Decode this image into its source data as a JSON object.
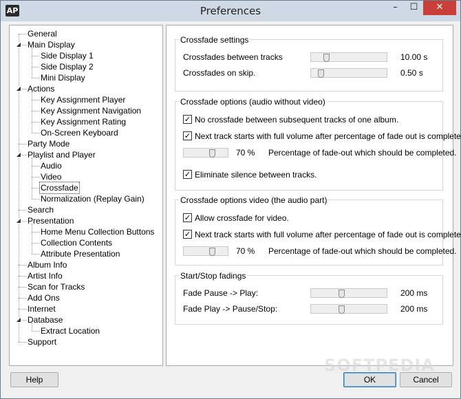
{
  "window": {
    "title": "Preferences",
    "app_icon_text": "AP",
    "minimize_glyph": "–",
    "maximize_glyph": "☐",
    "close_glyph": "✕"
  },
  "tree": {
    "items": [
      {
        "label": "General",
        "level": 0,
        "expander": ""
      },
      {
        "label": "Main Display",
        "level": 0,
        "expander": "◢"
      },
      {
        "label": "Side Display 1",
        "level": 1,
        "expander": ""
      },
      {
        "label": "Side Display 2",
        "level": 1,
        "expander": ""
      },
      {
        "label": "Mini Display",
        "level": 1,
        "expander": ""
      },
      {
        "label": "Actions",
        "level": 0,
        "expander": "◢"
      },
      {
        "label": "Key Assignment Player",
        "level": 1,
        "expander": ""
      },
      {
        "label": "Key Assignment Navigation",
        "level": 1,
        "expander": ""
      },
      {
        "label": "Key Assignment Rating",
        "level": 1,
        "expander": ""
      },
      {
        "label": "On-Screen Keyboard",
        "level": 1,
        "expander": ""
      },
      {
        "label": "Party Mode",
        "level": 0,
        "expander": ""
      },
      {
        "label": "Playlist and Player",
        "level": 0,
        "expander": "◢"
      },
      {
        "label": "Audio",
        "level": 1,
        "expander": ""
      },
      {
        "label": "Video",
        "level": 1,
        "expander": ""
      },
      {
        "label": "Crossfade",
        "level": 1,
        "expander": "",
        "selected": true
      },
      {
        "label": "Normalization (Replay Gain)",
        "level": 1,
        "expander": ""
      },
      {
        "label": "Search",
        "level": 0,
        "expander": ""
      },
      {
        "label": "Presentation",
        "level": 0,
        "expander": "◢"
      },
      {
        "label": "Home Menu Collection Buttons",
        "level": 1,
        "expander": ""
      },
      {
        "label": "Collection Contents",
        "level": 1,
        "expander": ""
      },
      {
        "label": "Attribute Presentation",
        "level": 1,
        "expander": ""
      },
      {
        "label": "Album Info",
        "level": 0,
        "expander": ""
      },
      {
        "label": "Artist Info",
        "level": 0,
        "expander": ""
      },
      {
        "label": "Scan for Tracks",
        "level": 0,
        "expander": ""
      },
      {
        "label": "Add Ons",
        "level": 0,
        "expander": ""
      },
      {
        "label": "Internet",
        "level": 0,
        "expander": ""
      },
      {
        "label": "Database",
        "level": 0,
        "expander": "◢"
      },
      {
        "label": "Extract Location",
        "level": 1,
        "expander": ""
      },
      {
        "label": "Support",
        "level": 0,
        "expander": ""
      }
    ]
  },
  "crossfade_settings": {
    "title": "Crossfade settings",
    "between_tracks_label": "Crossfades between tracks",
    "between_tracks_value": "10.00 s",
    "between_tracks_level": 0.18,
    "on_skip_label": "Crossfades on skip.",
    "on_skip_value": "0.50 s",
    "on_skip_level": 0.1
  },
  "options_audio": {
    "title": "Crossfade options (audio without video)",
    "no_crossfade_label": "No crossfade between subsequent tracks of one album.",
    "no_crossfade_checked": true,
    "full_volume_label": "Next track starts with full volume after percentage of fade out is completed",
    "full_volume_checked": true,
    "percentage_value": "70 %",
    "percentage_level": 0.7,
    "percentage_label": "Percentage of fade-out which should be completed.",
    "eliminate_label": "Eliminate silence between tracks.",
    "eliminate_checked": true
  },
  "options_video": {
    "title": "Crossfade options video (the audio part)",
    "allow_label": "Allow crossfade for video.",
    "allow_checked": true,
    "full_volume_label": "Next track starts with full volume after percentage of fade out is completed",
    "full_volume_checked": true,
    "percentage_value": "70 %",
    "percentage_level": 0.7,
    "percentage_label": "Percentage of fade-out which should be completed."
  },
  "start_stop": {
    "title": "Start/Stop fadings",
    "pause_play_label": "Fade Pause -> Play:",
    "pause_play_value": "200 ms",
    "pause_play_level": 0.4,
    "play_pause_label": "Fade Play -> Pause/Stop:",
    "play_pause_value": "200 ms",
    "play_pause_level": 0.4
  },
  "buttons": {
    "help": "Help",
    "ok": "OK",
    "cancel": "Cancel"
  },
  "watermark": "SOFTPEDIA",
  "checkmark_glyph": "✓"
}
